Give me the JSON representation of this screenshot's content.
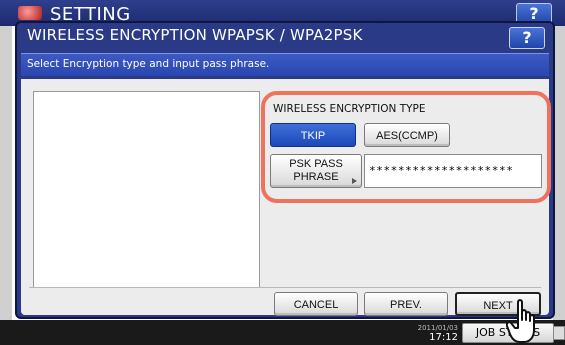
{
  "background": {
    "title": "SETTING",
    "help_label": "?",
    "datetime": "17:12",
    "datetime_top": "2011/01/03",
    "job_status_label": "JOB STATUS"
  },
  "dialog": {
    "title": "WIRELESS ENCRYPTION WPAPSK / WPA2PSK",
    "help_label": "?",
    "message": "Select Encryption type and input pass phrase.",
    "encryption_type_label": "WIRELESS ENCRYPTION TYPE",
    "encryption_options": [
      {
        "label": "TKIP",
        "selected": true
      },
      {
        "label": "AES(CCMP)",
        "selected": false
      }
    ],
    "psk_button_line1": "PSK PASS",
    "psk_button_line2": "PHRASE",
    "psk_value": "********************",
    "footer_buttons": {
      "cancel": "CANCEL",
      "prev": "PREV.",
      "next": "NEXT"
    }
  },
  "colors": {
    "dialog_bg": "#2a3a86",
    "selected_button": "#1c48b8",
    "highlight_ring": "#f0715c"
  },
  "icons": {
    "help": "question-mark-icon",
    "pointer": "hand-pointer-icon"
  }
}
